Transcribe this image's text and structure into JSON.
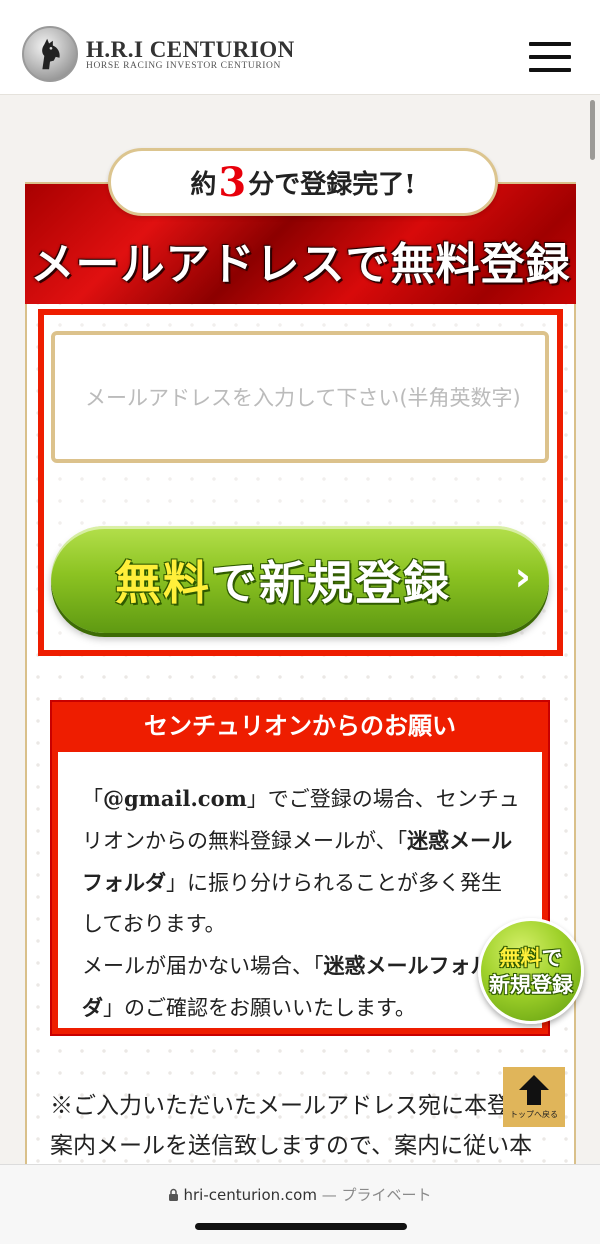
{
  "header": {
    "logo_title": "H.R.I CENTURION",
    "logo_subtitle": "HORSE RACING INVESTOR CENTURION",
    "logo_icon": "horse-head-emblem-icon",
    "menu_icon": "hamburger-menu-icon"
  },
  "signup_card": {
    "pill_prefix": "約",
    "pill_number": "3",
    "pill_suffix": "分で登録完了!",
    "banner_title": "メールアドレスで無料登録",
    "email_placeholder": "メールアドレスを入力して下さい(半角英数字)",
    "button_highlight": "無料",
    "button_rest": "で新規登録",
    "button_chevron": "›"
  },
  "notice": {
    "title": "センチュリオンからのお願い",
    "line1_a": "「",
    "line1_bold": "@gmail.com",
    "line1_b": "」でご登録の場合、センチュリオンからの無料登録メールが、「",
    "line1_bold2": "迷惑メールフォルダ",
    "line1_c": "」に振り分けられることが多く発生しております。",
    "line2_a": "メールが届かない場合、「",
    "line2_bold": "迷惑メールフォルダ",
    "line2_b": "」のご確認をお願いいたします。"
  },
  "footnote": "※ご入力いただいたメールアドレス宛に本登録の案内メールを送信致しますので、案内に従い本",
  "float_signup": {
    "highlight": "無料",
    "line1_rest": "で",
    "line2": "新規登録"
  },
  "back_to_top": {
    "label": "トップへ戻る",
    "icon": "arrow-up-icon"
  },
  "browser": {
    "url": "hri-centurion.com",
    "separator": " — ",
    "privacy": "プライベート",
    "lock_icon": "lock-icon"
  },
  "colors": {
    "accent_red": "#ee1d00",
    "gold_border": "#dcc28c",
    "button_green": "#8cc322",
    "highlight_yellow": "#ffef3a"
  }
}
